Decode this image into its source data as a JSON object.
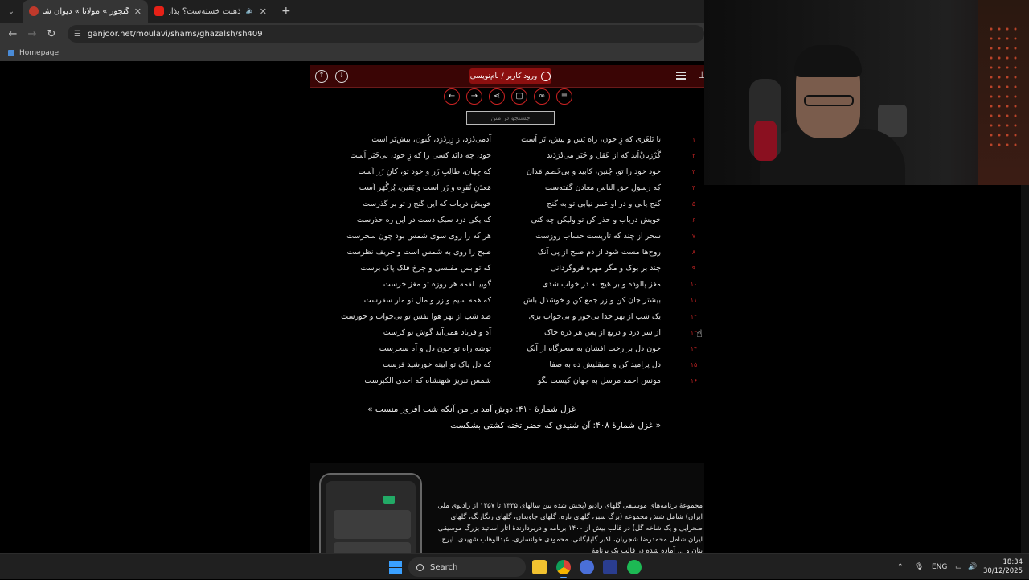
{
  "browser": {
    "tabs": [
      {
        "title": "گنجور » مولانا » دیوان شمس » غز",
        "fav_color": "#c0392b",
        "active": true
      },
      {
        "title": "ذهنت خسته‌ست؟ بذار بارون",
        "fav_color": "#e62117",
        "active": false
      }
    ],
    "new_tab_label": "+",
    "url": "ganjoor.net/moulavi/shams/ghazalsh/sh409",
    "bookmark": "Homepage"
  },
  "site": {
    "login_label": "ورود کاربر / نام‌نویسی",
    "search_placeholder": "جستجو در متن",
    "verses": [
      {
        "n": "۱",
        "m1": "تا نَلغَزی که زِ خون، راه پَس و پیش، تَر اَست",
        "m2": "آدمی‌دُزد، ز زِردُزد، کُنون، بیش‌تَر است"
      },
      {
        "n": "۲",
        "m1": "گُرْزبانْ‌اَند که از عَقل و خَبَر می‌دُزدَند",
        "m2": "خود، چه دانَد کسی را که زِ خود، بی‌خَبَر اَست"
      },
      {
        "n": "۳",
        "m1": "خود خود را تو، چُنین، کابید و بی‌خَصم مَدان",
        "m2": "کِه جِهان، طالِبِ زَر و خود تو، کانِ زَر اَست"
      },
      {
        "n": "۴",
        "m1": "کِه رسولِ حق الناس معادن گفته‌ست",
        "m2": "مَعدَنِ نُقرِه و زَر اَست و یَقین، پُرگُهَر اَست"
      },
      {
        "n": "۵",
        "m1": "گنج یابی و در او عمر نیابی تو به گنج",
        "m2": "خویش درباب که این گنج ز تو بر گذرست"
      },
      {
        "n": "۶",
        "m1": "خویش درباب و حذر کن تو ولیکن چه کنی",
        "m2": "که یکی دزد سبک دست در این ره حذرست"
      },
      {
        "n": "۷",
        "m1": "سحر از چند که تاریست حساب روزست",
        "m2": "هر که را روی سوی شمس بود چون سحرست"
      },
      {
        "n": "۸",
        "m1": "روح‌ها مست شود از دم صبح از پی آنک",
        "m2": "صبح را روی به شمس است و حریف نظرست"
      },
      {
        "n": "۹",
        "m1": "چند بر بوک و مگر مهره فروگردانی",
        "m2": "که تو بس مفلسی و چرخ فلک پاک برست"
      },
      {
        "n": "۱۰",
        "m1": "مغز پالوده و بر هیچ نه در خواب شدی",
        "m2": "گوییا لقمه هر روزه تو مغز خرست"
      },
      {
        "n": "۱۱",
        "m1": "بیشتر جان کن و زر جمع کن و خوشدل باش",
        "m2": "که همه سیم و زر و مال تو مار سقرست"
      },
      {
        "n": "۱۲",
        "m1": "یک شب از بهر خدا بی‌خور و بی‌خواب بزی",
        "m2": "صد شب از بهر هوا نفس تو بی‌خواب و خورست"
      },
      {
        "n": "۱۳",
        "m1": "از سر درد و دریغ از پس هر ذره خاک",
        "m2": "آه و فریاد همی‌آید گوش تو کرست"
      },
      {
        "n": "۱۴",
        "m1": "خون دل بر رخت افشان به سحرگاه از آنک",
        "m2": "توشه راه تو خون دل و آه سحرست"
      },
      {
        "n": "۱۵",
        "m1": "دل پرامید کن و صیقلیش ده به صفا",
        "m2": "که دل پاک تو آیینه خورشید فرست"
      },
      {
        "n": "۱۶",
        "m1": "مونس احمد مرسل به جهان کیست بگو",
        "m2": "شمس تبریز شهنشاه که احدی الکبرست"
      }
    ],
    "next_link": "غزل شمارهٔ ۴۱۰: دوش آمد بر من آنکه شب افروز منست »",
    "prev_link": "« غزل شمارهٔ ۴۰۸: آن شنیدی که خضر تخته کشتی بشکست",
    "promo_text": "مجموعهٔ برنامه‌های موسیقی گلهای رادیو (پخش شده بین سالهای ۱۳۳۵ تا ۱۳۵۷ از رادیوی ملی ایران) شامل شش مجموعه (برگ سبز، گلهای تازه، گلهای جاویدان، گلهای رنگارنگ، گلهای صحرایی و یک شاخه گل) در قالب بیش از ۱۴۰۰ برنامه و دربردارندهٔ آثار اساتید بزرگ موسیقی ایران شامل محمدرضا شجریان، اکبر گلپایگانی، محمودی خوانساری، عبدالوهاب شهیدی، ایرج، بنان و ... آماده شده در قالب یک برنامهٔ"
  },
  "taskbar": {
    "search_label": "Search",
    "lang": "ENG",
    "time": "18:34",
    "date": "30/12/2025"
  }
}
